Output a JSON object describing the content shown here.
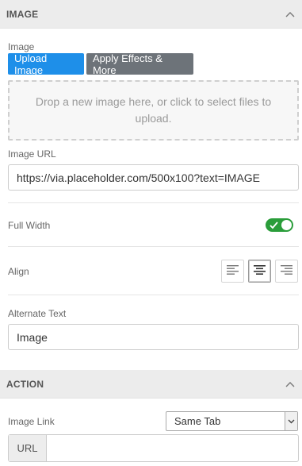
{
  "image_section": {
    "title": "IMAGE",
    "image_label": "Image",
    "upload_button": "Upload Image",
    "effects_button": "Apply Effects & More",
    "dropzone_text": "Drop a new image here, or click to select files to upload.",
    "image_url_label": "Image URL",
    "image_url_value": "https://via.placeholder.com/500x100?text=IMAGE",
    "full_width_label": "Full Width",
    "full_width_on": true,
    "align_label": "Align",
    "align_options": [
      "left",
      "center",
      "right"
    ],
    "align_selected": "center",
    "alt_text_label": "Alternate Text",
    "alt_text_value": "Image"
  },
  "action_section": {
    "title": "ACTION",
    "image_link_label": "Image Link",
    "link_target_selected": "Same Tab",
    "url_prefix": "URL",
    "url_value": ""
  },
  "colors": {
    "primary_button": "#1e8fe9",
    "secondary_button": "#6d7379",
    "toggle_on": "#2a9d3a",
    "header_bg": "#ececec"
  }
}
